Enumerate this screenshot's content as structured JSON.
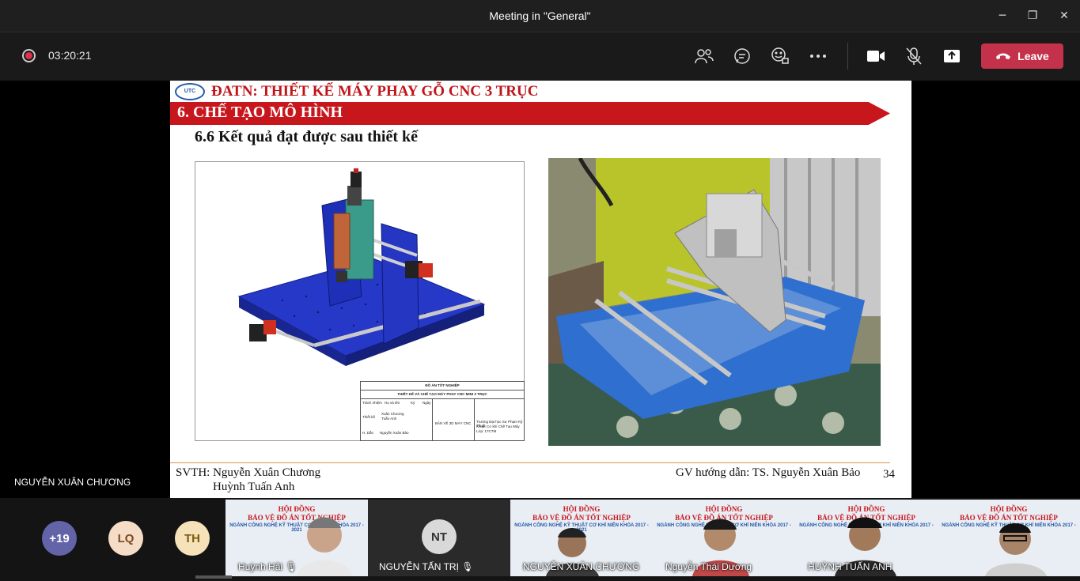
{
  "window": {
    "title": "Meeting in \"General\"",
    "minimize_glyph": "─",
    "maximize_glyph": "❐",
    "close_glyph": "✕"
  },
  "toolbar": {
    "recording_time": "03:20:21",
    "leave_label": "Leave",
    "icons": [
      "people-icon",
      "chat-icon",
      "reactions-icon",
      "more-icon",
      "camera-icon",
      "mic-off-icon",
      "share-icon",
      "phone-hangup-icon"
    ],
    "leave_color": "#c4314b"
  },
  "stage": {
    "presenter_name": "NGUYỄN XUÂN CHƯƠNG"
  },
  "slide": {
    "logo_text": "UTC",
    "course_title": "ĐATN: THIẾT KẾ MÁY PHAY GỖ CNC 3 TRỤC",
    "section_title": "6. CHẾ TẠO MÔ HÌNH",
    "sub_title": "6.6 Kết quả đạt được sau thiết kế",
    "title_block": {
      "line1": "ĐỒ ÁN TỐT NGHIỆP",
      "line2": "THIẾT KẾ VÀ CHẾ TẠO MÁY PHAY CNC MINI 3 TRỤC",
      "line3": "BẢN VẼ 3D MÁY CNC",
      "line4": "Trường Đại học Sư Phạm Kỹ Thuật",
      "line5": "Khoa: Cơ khí Chế Tạo Máy",
      "line6": "Lớp: 17CTM",
      "row_thietke": "Thiết kế",
      "row_hd": "H. Dẫn",
      "names1": "Xuân Chương",
      "names2": "Tuấn Anh",
      "names3": "Nguyễn Xuân Bảo",
      "col_hoten": "Họ và tên",
      "col_ky": "Ký",
      "col_ngay": "Ngày",
      "col_trachnhiem": "Trách nhiệm"
    },
    "footer_left_1": "SVTH: Nguyễn Xuân Chương",
    "footer_left_2": "Huỳnh Tuấn Anh",
    "footer_right": "GV hướng dẫn: TS. Nguyễn Xuân Bảo",
    "page_number": "34",
    "accent_red": "#c8161d"
  },
  "gallery": {
    "overflow_count": "+19",
    "avatars": [
      {
        "initials": "LQ",
        "color": "#f5dcc6",
        "text_color": "#7a4a20"
      },
      {
        "initials": "TH",
        "color": "#f5e2b8",
        "text_color": "#7a5a10"
      }
    ],
    "tiles": [
      {
        "name": "Huỳnh Hải",
        "muted": true
      },
      {
        "name": "NGUYỄN TẤN TRỊ",
        "initials": "NT",
        "muted": true
      },
      {
        "name": "NGUYỄN XUÂN CHƯƠNG",
        "muted": false
      },
      {
        "name": "Nguyễn Thái Dương",
        "muted": false
      },
      {
        "name": "HUỲNH TUẤN ANH",
        "muted": false
      },
      {
        "name": "",
        "muted": false
      }
    ],
    "banner_line1": "HỘI ĐỒNG",
    "banner_line2": "BẢO VỆ ĐỒ ÁN TỐT NGHIỆP",
    "banner_line3": "NGÀNH CÔNG NGHỆ KỸ THUẬT CƠ KHÍ NIÊN KHÓA 2017 - 2021"
  }
}
